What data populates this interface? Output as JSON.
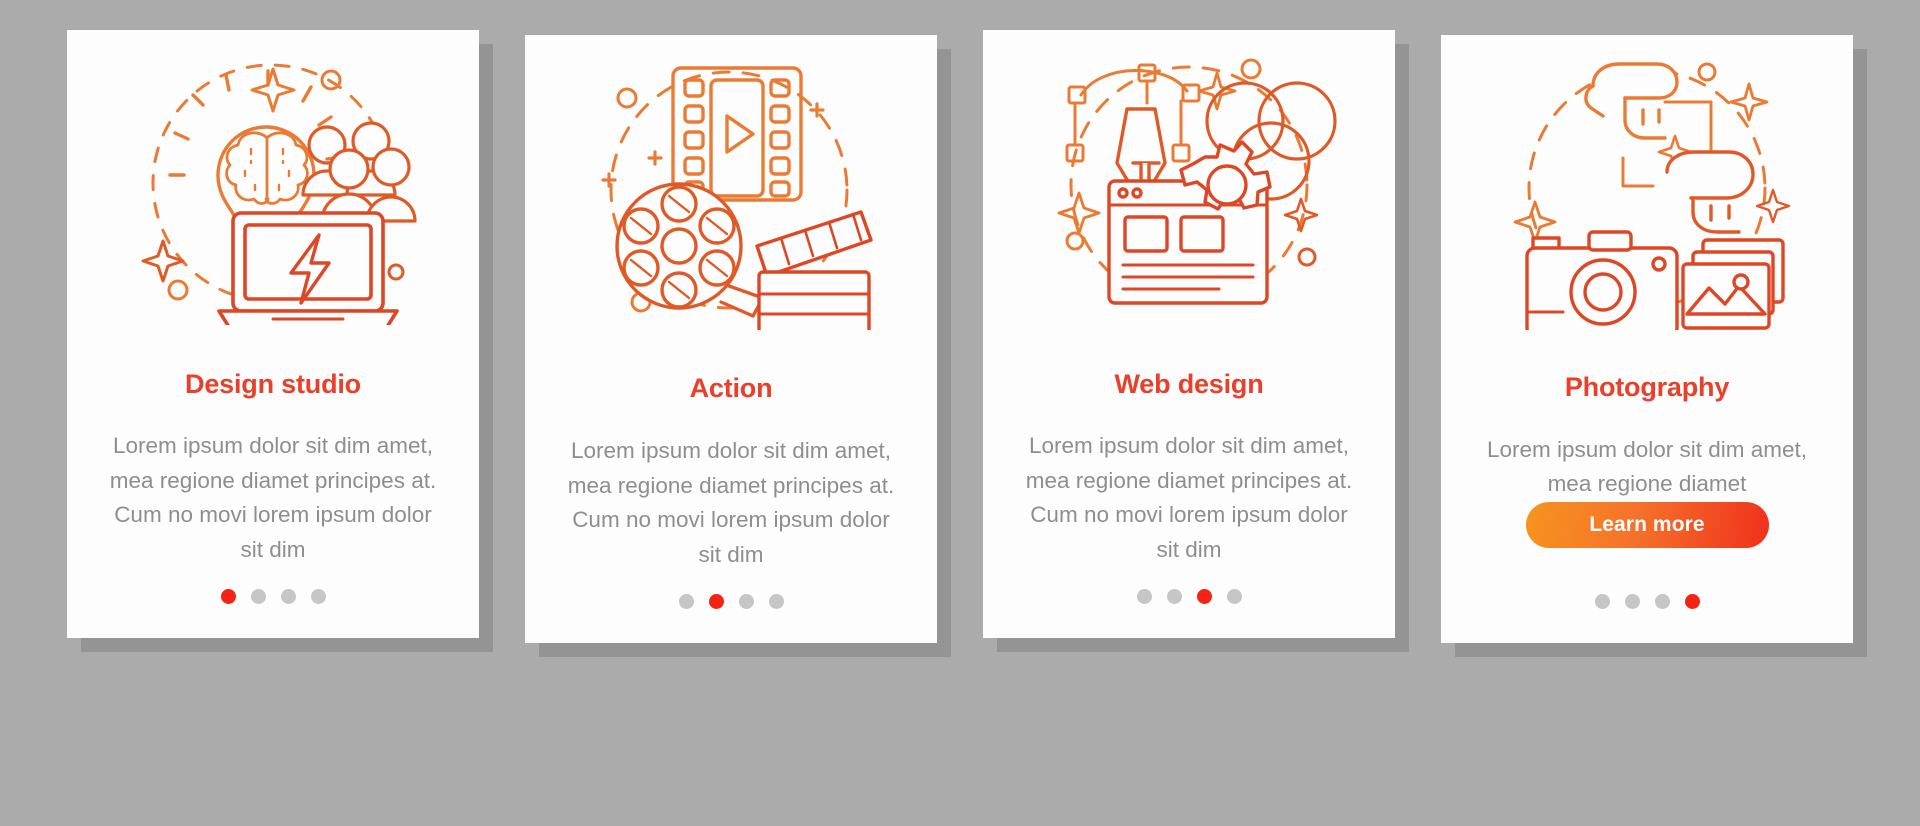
{
  "meta": {
    "background_color": "#ababab",
    "card_background": "#fdfdfd",
    "accent_color": "#e8402a",
    "accent_color_bright": "#f42314",
    "body_text_color": "#8e8e8e",
    "dot_inactive_color": "#c6c6c6",
    "button_gradient_from": "#f7941e",
    "button_gradient_to": "#f0301c"
  },
  "cards": [
    {
      "id": "design-studio",
      "title": "Design studio",
      "body": "Lorem ipsum dolor sit dim amet, mea regione diamet principes at. Cum no movi lorem ipsum dolor sit dim",
      "illustration": "lightbulb-brain-people-laptop-illustration",
      "has_button": false,
      "button_label": "",
      "dots": {
        "count": 4,
        "active_index": 0
      }
    },
    {
      "id": "action",
      "title": "Action",
      "body": "Lorem ipsum dolor sit dim amet, mea regione diamet principes at. Cum no movi lorem ipsum dolor sit dim",
      "illustration": "filmstrip-reel-clapperboard-illustration",
      "has_button": false,
      "button_label": "",
      "dots": {
        "count": 4,
        "active_index": 1
      }
    },
    {
      "id": "web-design",
      "title": "Web design",
      "body": "Lorem ipsum dolor sit dim amet, mea regione diamet principes at. Cum no movi lorem ipsum dolor sit dim",
      "illustration": "pen-tool-venn-gear-browser-illustration",
      "has_button": false,
      "button_label": "",
      "dots": {
        "count": 4,
        "active_index": 2
      }
    },
    {
      "id": "photography",
      "title": "Photography",
      "body": "Lorem ipsum dolor sit dim amet, mea regione diamet",
      "illustration": "hand-camera-photos-illustration",
      "has_button": true,
      "button_label": "Learn more",
      "dots": {
        "count": 4,
        "active_index": 3
      }
    }
  ]
}
